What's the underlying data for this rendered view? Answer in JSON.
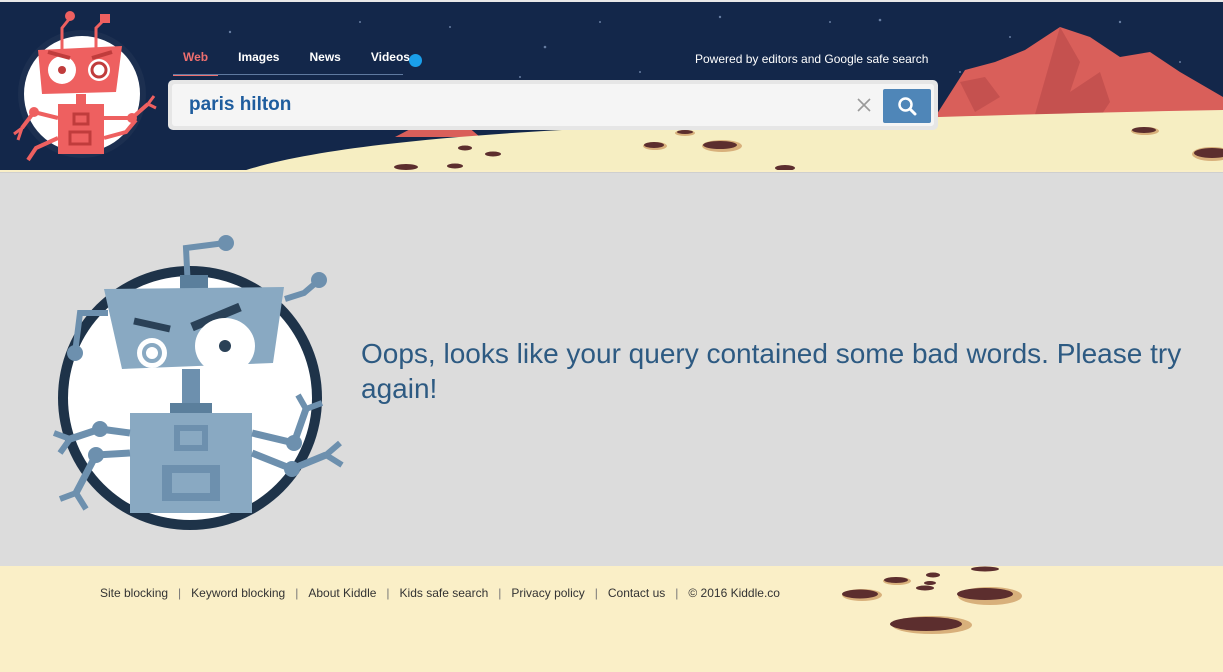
{
  "header": {
    "nav": {
      "tabs": [
        {
          "label": "Web",
          "active": true
        },
        {
          "label": "Images",
          "active": false
        },
        {
          "label": "News",
          "active": false
        },
        {
          "label": "Videos",
          "active": false
        }
      ]
    },
    "powered_by": "Powered by editors and Google safe search",
    "search": {
      "value": "paris hilton",
      "clear_icon": "close-icon",
      "submit_icon": "search-icon"
    }
  },
  "main": {
    "message": "Oops, looks like your query contained some bad words. Please try again!"
  },
  "footer": {
    "links": [
      {
        "label": "Site blocking"
      },
      {
        "label": "Keyword blocking"
      },
      {
        "label": "About Kiddle"
      },
      {
        "label": "Kids safe search"
      },
      {
        "label": "Privacy policy"
      },
      {
        "label": "Contact us"
      }
    ],
    "copyright": "© 2016 Kiddle.co"
  },
  "colors": {
    "header_bg": "#13274a",
    "accent_red": "#ee6f6f",
    "link_blue": "#1f5d9e",
    "message_blue": "#2d5a82",
    "search_button": "#4f86b8",
    "main_bg": "#dcdcdc",
    "sand": "#faefc7"
  }
}
